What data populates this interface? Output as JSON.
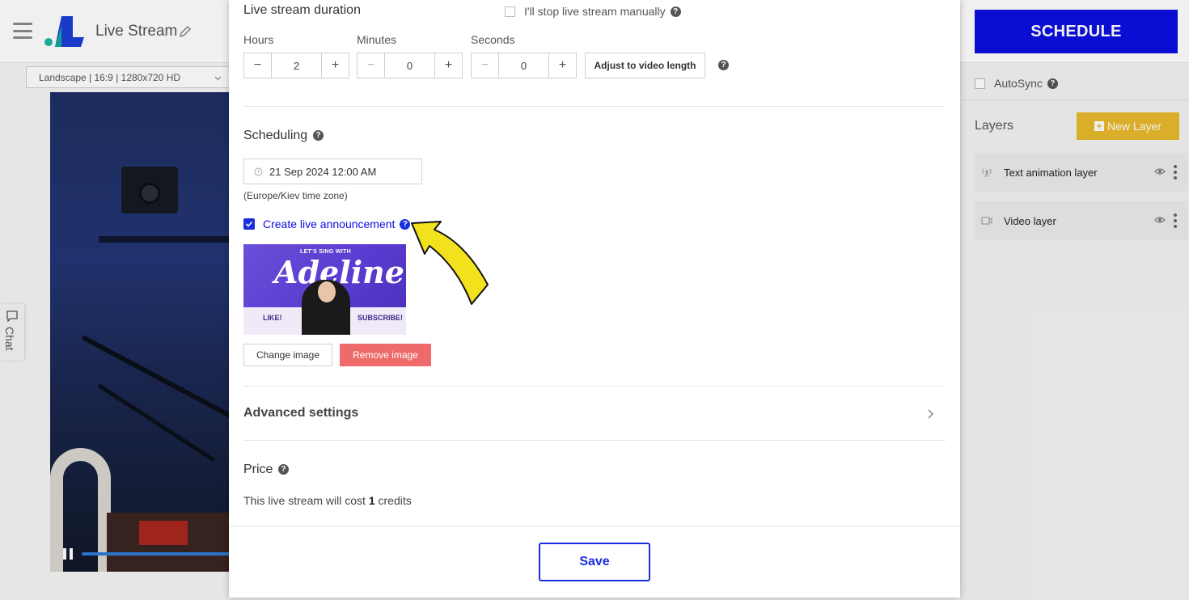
{
  "header": {
    "app_title": "Live Stream",
    "schedule_label": "SCHEDULE"
  },
  "format_select": {
    "value": "Landscape | 16:9 | 1280x720 HD"
  },
  "chat": {
    "label": "Chat"
  },
  "right_panel": {
    "autosync_label": "AutoSync",
    "layers_title": "Layers",
    "new_layer_label": "New Layer",
    "layers": [
      {
        "name": "Text animation layer",
        "icon": "broadcast-icon"
      },
      {
        "name": "Video layer",
        "icon": "video-camera-icon"
      }
    ]
  },
  "modal": {
    "duration": {
      "title": "Live stream duration",
      "manual_stop_label": "I'll stop live stream manually",
      "hours_label": "Hours",
      "hours_value": "2",
      "minutes_label": "Minutes",
      "minutes_value": "0",
      "seconds_label": "Seconds",
      "seconds_value": "0",
      "minus": "−",
      "plus": "+",
      "adjust_label": "Adjust to video length"
    },
    "scheduling": {
      "title": "Scheduling",
      "date_value": "21 Sep 2024 12:00 AM",
      "timezone_note": "(Europe/Kiev time zone)",
      "announcement_label": "Create live announcement",
      "announcement_checked": true,
      "thumbnail": {
        "top_text": "LET'S SING WITH",
        "name_text": "Adeline",
        "left_text": "LIKE!",
        "right_text": "SUBSCRIBE!"
      },
      "change_image_label": "Change image",
      "remove_image_label": "Remove image"
    },
    "advanced": {
      "label": "Advanced settings"
    },
    "price": {
      "title": "Price",
      "cost_prefix": "This live stream will cost",
      "cost_value": "1",
      "cost_suffix": "credits"
    },
    "save_label": "Save"
  },
  "help_glyph": "?",
  "colors": {
    "brand_blue": "#0c0ee0",
    "new_layer_yellow": "#e8b92c",
    "remove_red": "#ef6b6b",
    "arrow_yellow": "#f2e21e"
  }
}
